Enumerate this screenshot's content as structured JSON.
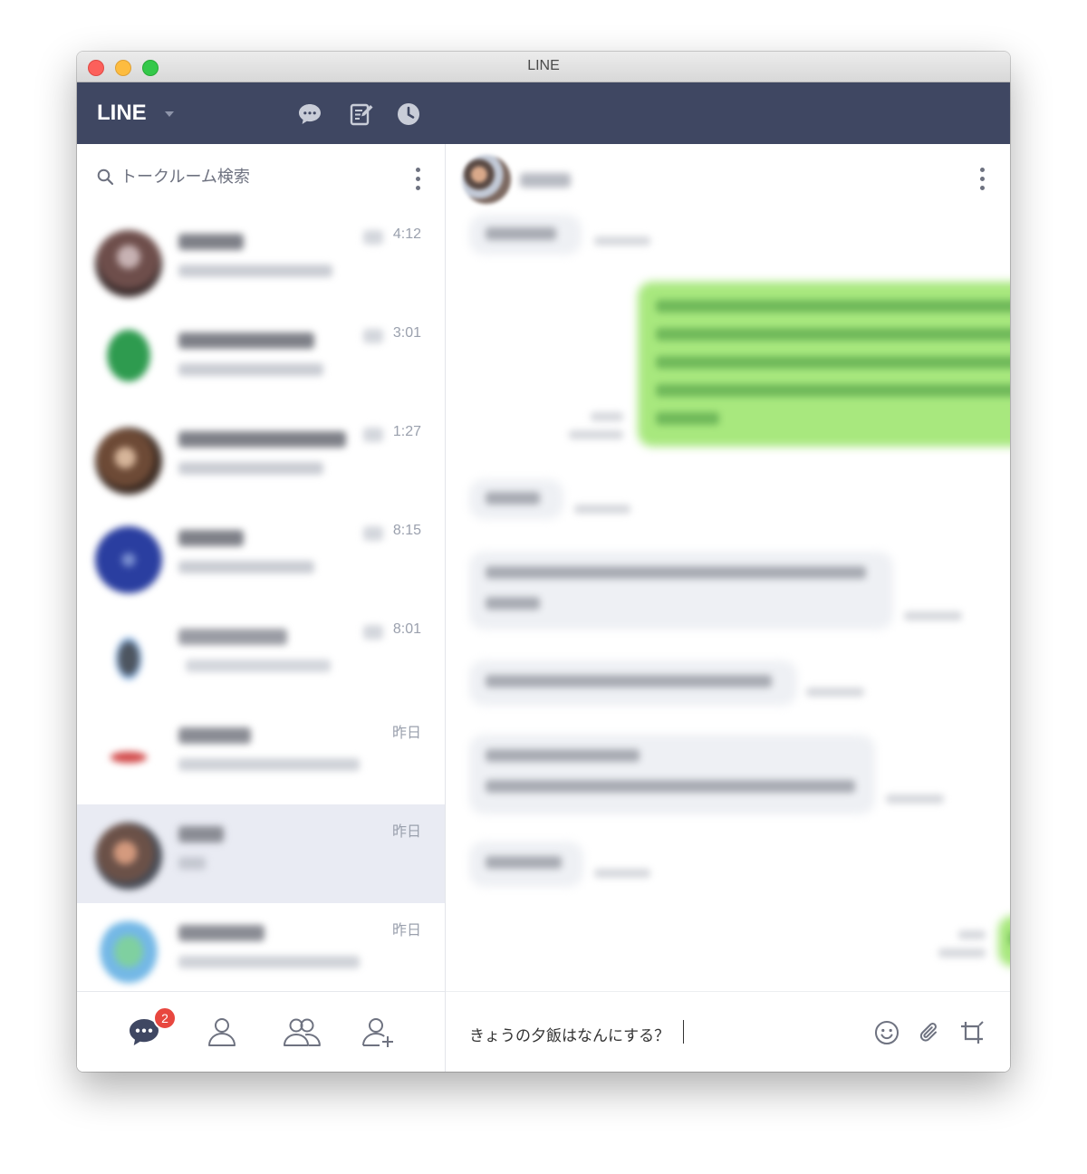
{
  "window": {
    "title": "LINE"
  },
  "header": {
    "logo": "LINE"
  },
  "sidebar": {
    "search": {
      "placeholder": "トークルーム検索",
      "value": ""
    },
    "chats": [
      {
        "time": "4:12"
      },
      {
        "time": "3:01"
      },
      {
        "time": "1:27"
      },
      {
        "time": "8:15"
      },
      {
        "time": "8:01"
      },
      {
        "time": "昨日"
      },
      {
        "time": "昨日"
      },
      {
        "time": "昨日"
      }
    ],
    "tabs": {
      "chat_badge": "2"
    }
  },
  "composer": {
    "value": "きょうの夕飯はなんにする？",
    "placeholder": ""
  },
  "colors": {
    "header_bg": "#3f4762",
    "active_chat_bg": "#e9ebf3",
    "outgoing_bubble": "#a8e87e",
    "incoming_bubble": "#eef0f4",
    "badge": "#e8473f"
  },
  "icons": {
    "header": [
      "chat-bubble-icon",
      "note-icon",
      "clock-icon"
    ],
    "bottom_tabs": [
      "chats-icon",
      "friend-icon",
      "groups-icon",
      "add-friend-icon"
    ],
    "composer": [
      "emoji-icon",
      "attach-icon",
      "crop-icon"
    ]
  }
}
